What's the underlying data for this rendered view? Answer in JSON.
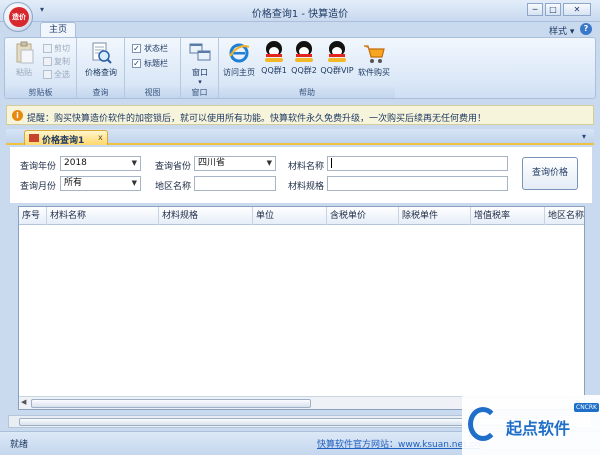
{
  "window": {
    "title": "价格查询1 - 快算造价",
    "app_logo_text": "造价",
    "controls": [
      "─",
      "□",
      "✕"
    ]
  },
  "ribbon": {
    "tabs": [
      {
        "label": "主页",
        "selected": true
      }
    ],
    "style_menu": "样式",
    "help": "?",
    "groups": {
      "clipboard": {
        "label": "剪贴板",
        "paste": "粘贴",
        "cut": "剪切",
        "copy": "复制",
        "select_all": "全选"
      },
      "query": {
        "label": "查询",
        "price_query": "价格查询"
      },
      "view": {
        "label": "视图",
        "statusbar": "状态栏",
        "titlebar": "标题栏",
        "statusbar_checked": true,
        "titlebar_checked": true
      },
      "window": {
        "label": "窗口",
        "window_btn": "窗口"
      },
      "help": {
        "label": "帮助",
        "home": "访问主页",
        "qq1": "QQ群1",
        "qq2": "QQ群2",
        "qqvip": "QQ群VIP",
        "buy": "软件购买"
      }
    }
  },
  "infobar": {
    "text": "提醒：购买快算造价软件的加密锁后，就可以使用所有功能。快算软件永久免费升级，一次购买后续再无任何费用！"
  },
  "doc_tabs": [
    {
      "label": "价格查询1",
      "close": "x"
    }
  ],
  "form": {
    "year_label": "查询年份",
    "year_value": "2018",
    "month_label": "查询月份",
    "month_value": "所有",
    "province_label": "查询省份",
    "province_value": "四川省",
    "region_label": "地区名称",
    "region_value": "",
    "material_name_label": "材料名称",
    "material_name_value": "",
    "material_spec_label": "材料规格",
    "material_spec_value": "",
    "search_button": "查询价格"
  },
  "grid": {
    "columns": [
      "序号",
      "材料名称",
      "材料规格",
      "单位",
      "含税单价",
      "除税单件",
      "增值税率",
      "地区名称"
    ],
    "rows": []
  },
  "statusbar": {
    "status": "就绪",
    "link": "快算软件官方网站：www.ksuan.net.cn"
  },
  "watermark": {
    "text": "起点软件",
    "badge": "CNCRK"
  }
}
